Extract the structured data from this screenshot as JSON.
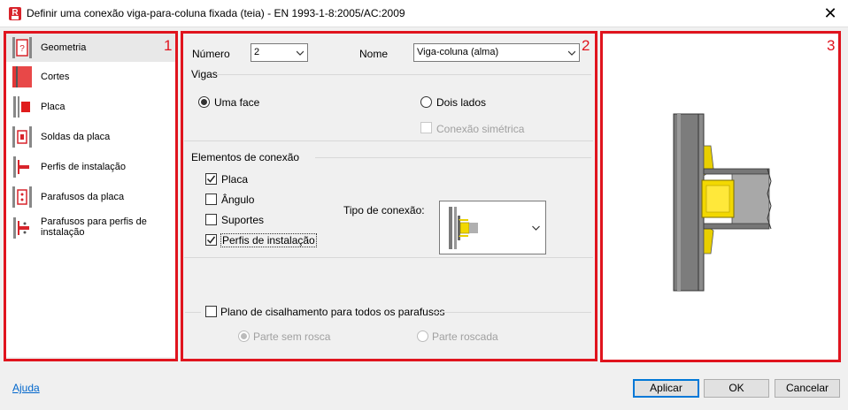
{
  "window": {
    "title": "Definir uma conexão viga-para-coluna fixada (teia) - EN 1993-1-8:2005/AC:2009",
    "app_icon_letter": "R",
    "close_glyph": "✕"
  },
  "annotations": {
    "box1": "1",
    "box2": "2",
    "box3": "3"
  },
  "colors": {
    "annotation_red": "#e0141e",
    "accent": "#0078d7",
    "steel_gray": "#808080",
    "plate_yellow": "#f2d800"
  },
  "nav": {
    "items": [
      {
        "label": "Geometria",
        "icon": "geometry-icon",
        "selected": true
      },
      {
        "label": "Cortes",
        "icon": "cuts-icon"
      },
      {
        "label": "Placa",
        "icon": "plate-icon"
      },
      {
        "label": "Soldas da placa",
        "icon": "plate-welds-icon"
      },
      {
        "label": "Perfis de instalação",
        "icon": "installation-profiles-icon"
      },
      {
        "label": "Parafusos da placa",
        "icon": "plate-bolts-icon"
      },
      {
        "label": "Parafusos para perfis de instalação",
        "icon": "profile-bolts-icon"
      }
    ]
  },
  "form": {
    "numero_label": "Número",
    "numero_value": "2",
    "nome_label": "Nome",
    "nome_value": "Viga-coluna (alma)",
    "vigas_label": "Vigas",
    "uma_face": "Uma face",
    "dois_lados": "Dois lados",
    "conexao_simetrica": "Conexão simétrica",
    "elementos_label": "Elementos de conexão",
    "placa": "Placa",
    "angulo": "Ângulo",
    "suportes": "Suportes",
    "perfis_instalacao": "Perfis de instalação",
    "tipo_conexao_label": "Tipo de conexão:",
    "plano_cisalhamento": "Plano de cisalhamento para todos os parafusos",
    "parte_sem_rosca": "Parte sem rosca",
    "parte_roscada": "Parte roscada",
    "state": {
      "vigas": "Uma face",
      "conexao_simetrica": false,
      "placa": true,
      "angulo": false,
      "suportes": false,
      "perfis_instalacao": true,
      "plano_cisalhamento": false,
      "rosca": "Parte sem rosca"
    }
  },
  "footer": {
    "help": "Ajuda",
    "apply": "Aplicar",
    "ok": "OK",
    "cancel": "Cancelar"
  }
}
